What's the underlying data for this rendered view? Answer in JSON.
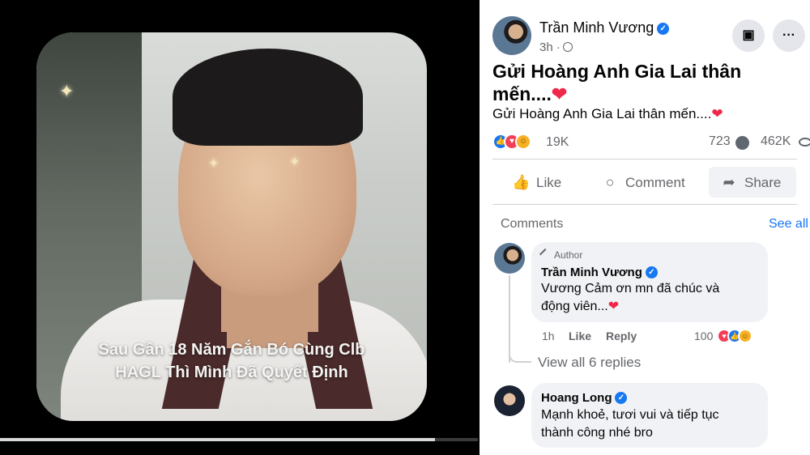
{
  "video": {
    "caption_line1": "Sau Gần 18 Năm Gắn Bó Cùng Clb",
    "caption_line2": "HAGL Thì Mình Đã Quyết Định",
    "progress": 0.91
  },
  "post": {
    "author": "Trần Minh Vương",
    "time": "3h",
    "title": "Gửi Hoàng Anh Gia Lai thân mến....",
    "title_emoji": "❤",
    "text": "Gửi Hoàng Anh Gia Lai thân mến....",
    "text_emoji": "❤",
    "reaction_count": "19K",
    "comment_count": "723",
    "view_count": "462K",
    "actions": {
      "like": "Like",
      "comment": "Comment",
      "share": "Share"
    }
  },
  "comments_section": {
    "label": "Comments",
    "see_all": "See all",
    "items": [
      {
        "badge": "Author",
        "name": "Trần Minh Vương",
        "text_line1": "Vương Cảm ơn mn đã chúc và",
        "text_line2": "động viên...",
        "emoji": "❤",
        "time": "1h",
        "like": "Like",
        "reply": "Reply",
        "reaction_count": "100",
        "view_replies": "View all 6 replies"
      },
      {
        "name": "Hoang Long",
        "text_line1": "Mạnh khoẻ, tươi vui và tiếp tục",
        "text_line2": "thành công nhé bro"
      }
    ]
  },
  "colors": {
    "accent": "#1877f2",
    "heart": "#f02849",
    "muted": "#65676b"
  },
  "icons": [
    "verified-icon",
    "globe-icon",
    "bookmark-icon",
    "more-icon",
    "like-icon",
    "comment-icon",
    "share-icon",
    "eye-icon",
    "pen-icon"
  ]
}
